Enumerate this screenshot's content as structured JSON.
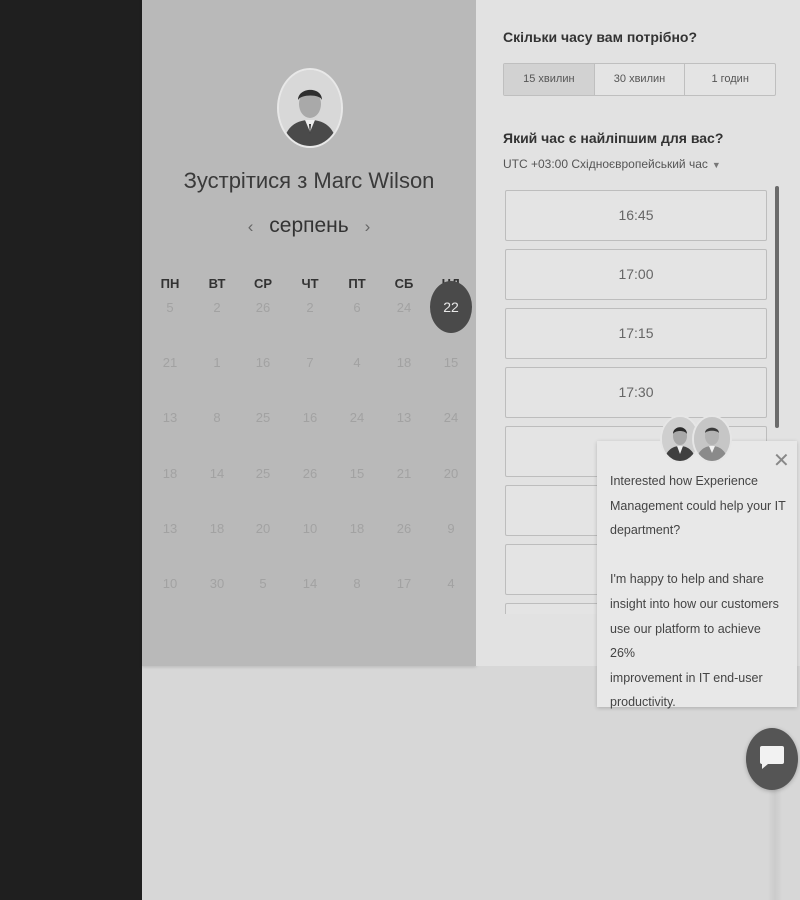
{
  "calendar": {
    "title": "Зустрітися з Marc Wilson",
    "month": "серпень",
    "prev_icon": "chevron-left-icon",
    "next_icon": "chevron-right-icon",
    "weekdays": [
      "ПН",
      "ВТ",
      "СР",
      "ЧТ",
      "ПТ",
      "СБ",
      "НД"
    ],
    "weeks": [
      [
        "5",
        "2",
        "26",
        "2",
        "6",
        "24",
        "22"
      ],
      [
        "21",
        "1",
        "16",
        "7",
        "4",
        "18",
        "15"
      ],
      [
        "13",
        "8",
        "25",
        "16",
        "24",
        "13",
        "24"
      ],
      [
        "18",
        "14",
        "25",
        "26",
        "15",
        "21",
        "20"
      ],
      [
        "13",
        "18",
        "20",
        "10",
        "18",
        "26",
        "9"
      ],
      [
        "10",
        "30",
        "5",
        "14",
        "8",
        "17",
        "4"
      ]
    ],
    "selected_day": "22"
  },
  "scheduler": {
    "duration_question": "Скільки часу вам потрібно?",
    "durations": [
      "15 хвилин",
      "30 хвилин",
      "1 годин"
    ],
    "time_question": "Який час є найліпшим для вас?",
    "timezone": "UTC +03:00 Східноєвропейський час",
    "slots": [
      "16:45",
      "17:00",
      "17:15",
      "17:30",
      "",
      "",
      "",
      ""
    ]
  },
  "chat": {
    "paragraph1": [
      "Interested how Experience",
      "Management could help your IT",
      "department?"
    ],
    "paragraph2": [
      "I'm happy to help and share",
      "insight into how our customers",
      "use our platform to achieve 26%",
      "improvement in IT end-user",
      "productivity."
    ],
    "close_icon": "close-icon",
    "launcher_icon": "chat-bubble-icon"
  },
  "colors": {
    "selected_day_bg": "#4a4a4a",
    "panel_bg": "#b9b9b9",
    "launcher_bg": "#555555"
  }
}
